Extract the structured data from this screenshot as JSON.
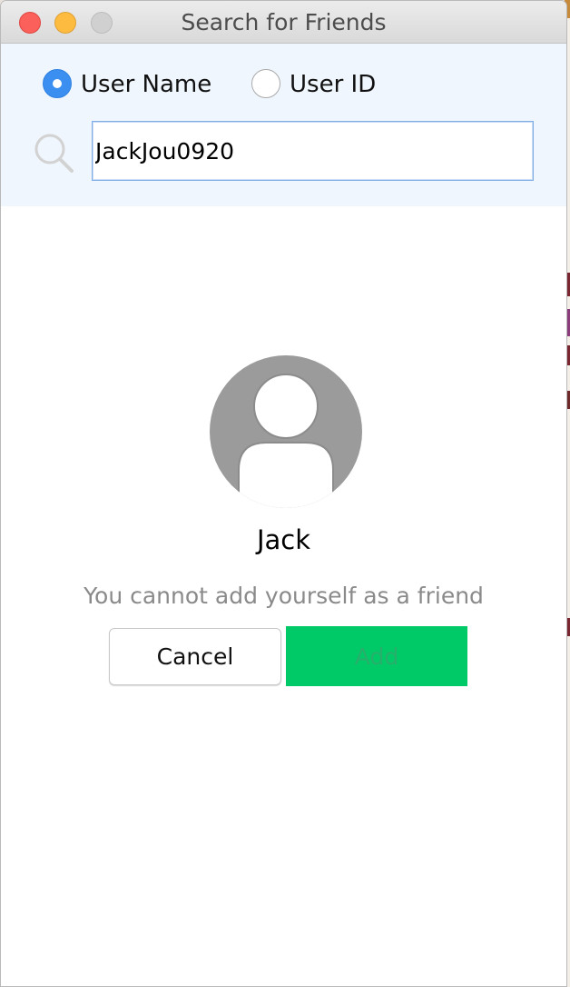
{
  "window": {
    "title": "Search for Friends"
  },
  "search": {
    "mode_options": [
      {
        "label": "User Name",
        "selected": true
      },
      {
        "label": "User ID",
        "selected": false
      }
    ],
    "query_value": "JackJou0920",
    "icon": "search-icon"
  },
  "result": {
    "name": "Jack",
    "message": "You cannot add yourself as a friend",
    "avatar_icon": "default-avatar-icon"
  },
  "actions": {
    "cancel_label": "Cancel",
    "add_label": "Add",
    "add_enabled": false
  },
  "colors": {
    "accent_blue": "#3a8ff1",
    "add_button_green": "#00c967",
    "panel_background": "#f0f6fd",
    "message_gray": "#8a8a8a"
  }
}
